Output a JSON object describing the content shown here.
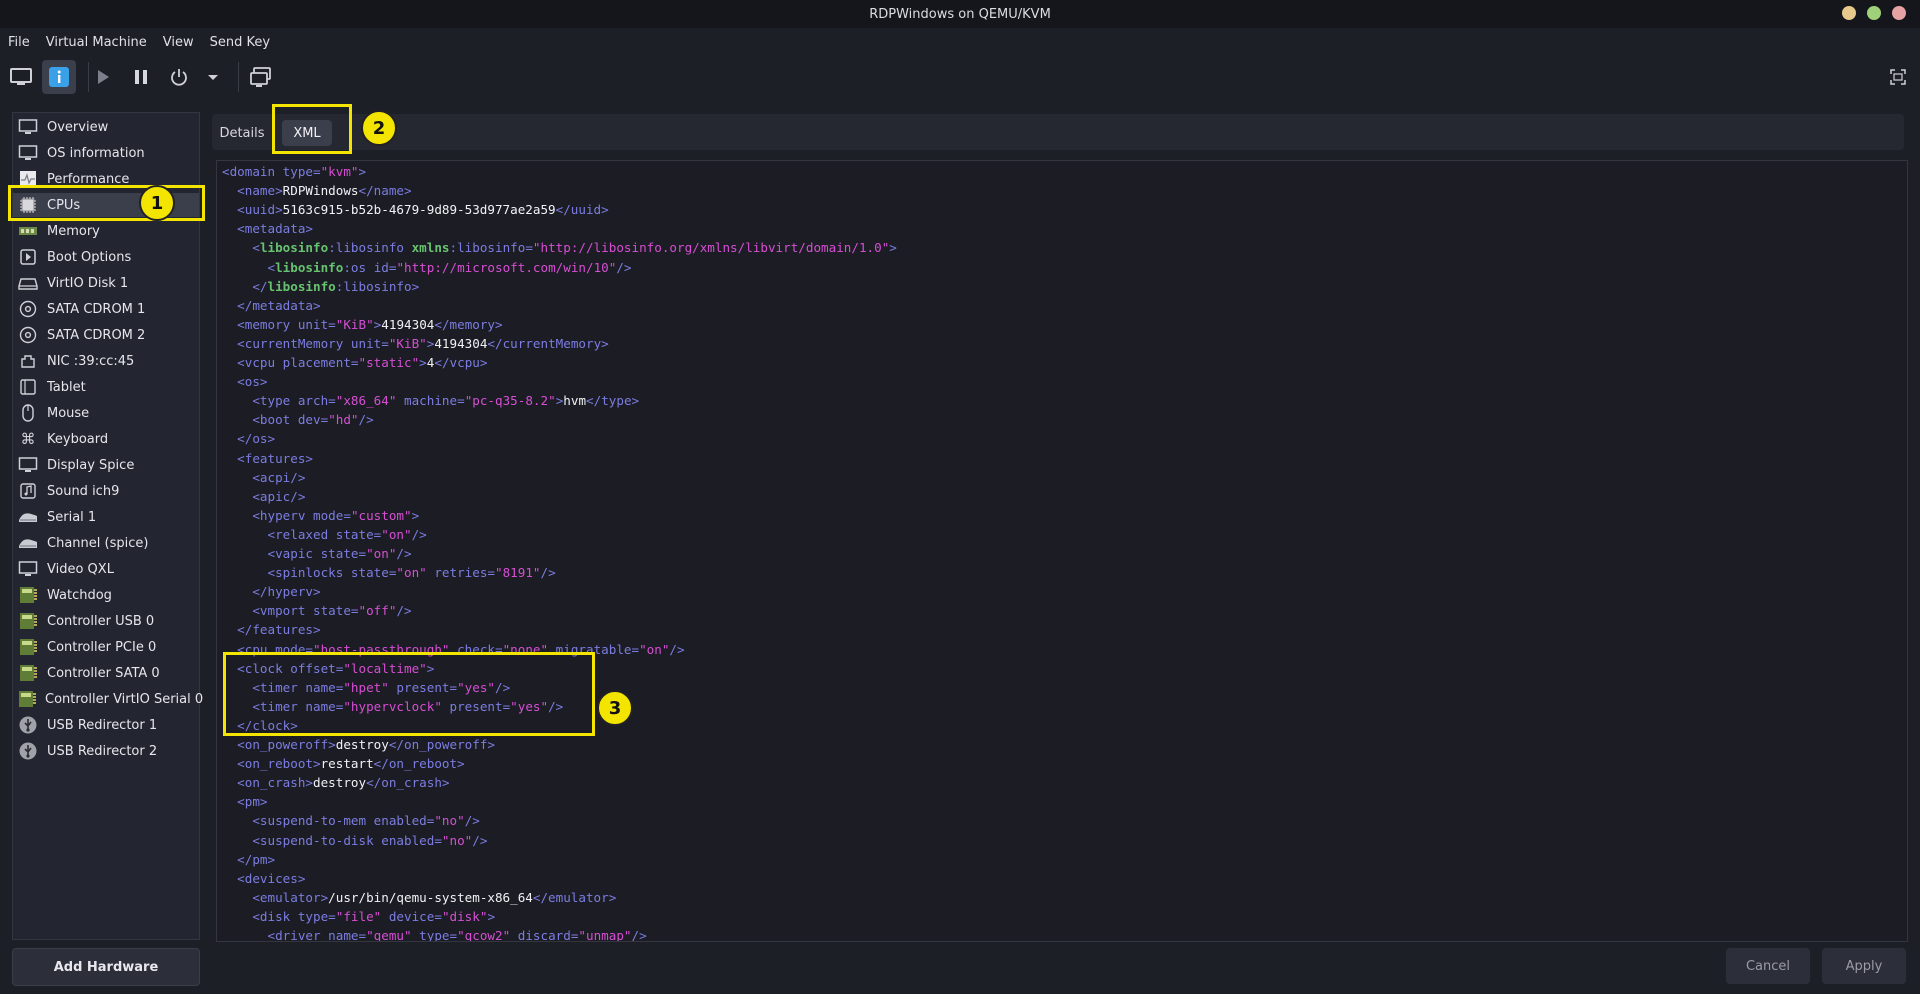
{
  "window": {
    "title": "RDPWindows on QEMU/KVM",
    "buttons": [
      "#e6c98b",
      "#9fd17a",
      "#e7a3a3"
    ]
  },
  "menu": [
    "File",
    "Virtual Machine",
    "View",
    "Send Key"
  ],
  "toolbar": {
    "icons": [
      "monitor-icon",
      "info-icon",
      "play-icon",
      "pause-icon",
      "power-icon",
      "dropdown-arrow-icon",
      "screenshot-icon",
      "fullscreen-icon"
    ]
  },
  "sidebar": {
    "items": [
      {
        "label": "Overview",
        "icon": "monitor-icon"
      },
      {
        "label": "OS information",
        "icon": "monitor-icon"
      },
      {
        "label": "Performance",
        "icon": "chart-icon"
      },
      {
        "label": "CPUs",
        "icon": "cpu-icon"
      },
      {
        "label": "Memory",
        "icon": "memory-icon"
      },
      {
        "label": "Boot Options",
        "icon": "boot-icon"
      },
      {
        "label": "VirtIO Disk 1",
        "icon": "disk-icon"
      },
      {
        "label": "SATA CDROM 1",
        "icon": "cdrom-icon"
      },
      {
        "label": "SATA CDROM 2",
        "icon": "cdrom-icon"
      },
      {
        "label": "NIC :39:cc:45",
        "icon": "network-icon"
      },
      {
        "label": "Tablet",
        "icon": "tablet-icon"
      },
      {
        "label": "Mouse",
        "icon": "mouse-icon"
      },
      {
        "label": "Keyboard",
        "icon": "keyboard-icon"
      },
      {
        "label": "Display Spice",
        "icon": "monitor-icon"
      },
      {
        "label": "Sound ich9",
        "icon": "sound-icon"
      },
      {
        "label": "Serial 1",
        "icon": "serial-icon"
      },
      {
        "label": "Channel (spice)",
        "icon": "serial-icon"
      },
      {
        "label": "Video QXL",
        "icon": "monitor-icon"
      },
      {
        "label": "Watchdog",
        "icon": "card-icon"
      },
      {
        "label": "Controller USB 0",
        "icon": "card-icon"
      },
      {
        "label": "Controller PCIe 0",
        "icon": "card-icon"
      },
      {
        "label": "Controller SATA 0",
        "icon": "card-icon"
      },
      {
        "label": "Controller VirtIO Serial 0",
        "icon": "card-icon"
      },
      {
        "label": "USB Redirector 1",
        "icon": "usb-icon"
      },
      {
        "label": "USB Redirector 2",
        "icon": "usb-icon"
      }
    ],
    "selected": "CPUs",
    "add_hardware": "Add Hardware"
  },
  "tabs": {
    "details": "Details",
    "xml": "XML",
    "active": "XML"
  },
  "xml_lines": [
    "0|<t><domain </t><a>type=</a><v>\"kvm\"</v><t>></t>",
    "1|<t><name></t><x>RDPWindows</x><t></name></t>",
    "1|<t><uuid></t><x>5163c915-b52b-4679-9d89-53d977ae2a59</x><t></uuid></t>",
    "1|<t><metadata></t>",
    "2|<t><</t><b>libosinfo</b><t>:libosinfo </t><b>xmlns</b><a>:libosinfo=</a><v>\"http://libosinfo.org/xmlns/libvirt/domain/1.0\"</v><t>></t>",
    "3|<t><</t><b>libosinfo</b><t>:os </t><a>id=</a><v>\"http://microsoft.com/win/10\"</v><t>/></t>",
    "2|<t></</t><b>libosinfo</b><t>:libosinfo></t>",
    "1|<t></metadata></t>",
    "1|<t><memory </t><a>unit=</a><v>\"KiB\"</v><t>></t><x>4194304</x><t></memory></t>",
    "1|<t><currentMemory </t><a>unit=</a><v>\"KiB\"</v><t>></t><x>4194304</x><t></currentMemory></t>",
    "1|<t><vcpu </t><a>placement=</a><v>\"static\"</v><t>></t><x>4</x><t></vcpu></t>",
    "1|<t><os></t>",
    "2|<t><type </t><a>arch=</a><v>\"x86_64\"</v><a> machine=</a><v>\"pc-q35-8.2\"</v><t>></t><x>hvm</x><t></type></t>",
    "2|<t><boot </t><a>dev=</a><v>\"hd\"</v><t>/></t>",
    "1|<t></os></t>",
    "1|<t><features></t>",
    "2|<t><acpi/></t>",
    "2|<t><apic/></t>",
    "2|<t><hyperv </t><a>mode=</a><v>\"custom\"</v><t>></t>",
    "3|<t><relaxed </t><a>state=</a><v>\"on\"</v><t>/></t>",
    "3|<t><vapic </t><a>state=</a><v>\"on\"</v><t>/></t>",
    "3|<t><spinlocks </t><a>state=</a><v>\"on\"</v><a> retries=</a><v>\"8191\"</v><t>/></t>",
    "2|<t></hyperv></t>",
    "2|<t><vmport </t><a>state=</a><v>\"off\"</v><t>/></t>",
    "1|<t></features></t>",
    "1|<t><cpu </t><a>mode=</a><v>\"host-passthrough\"</v><a> check=</a><v>\"none\"</v><a> migratable=</a><v>\"on\"</v><t>/></t>",
    "1|<t><clock </t><a>offset=</a><v>\"localtime\"</v><t>></t>",
    "2|<t><timer </t><a>name=</a><v>\"hpet\"</v><a> present=</a><v>\"yes\"</v><t>/></t>",
    "2|<t><timer </t><a>name=</a><v>\"hypervclock\"</v><a> present=</a><v>\"yes\"</v><t>/></t>",
    "1|<t></clock></t>",
    "1|<t><on_poweroff></t><x>destroy</x><t></on_poweroff></t>",
    "1|<t><on_reboot></t><x>restart</x><t></on_reboot></t>",
    "1|<t><on_crash></t><x>destroy</x><t></on_crash></t>",
    "1|<t><pm></t>",
    "2|<t><suspend-to-mem </t><a>enabled=</a><v>\"no\"</v><t>/></t>",
    "2|<t><suspend-to-disk </t><a>enabled=</a><v>\"no\"</v><t>/></t>",
    "1|<t></pm></t>",
    "1|<t><devices></t>",
    "2|<t><emulator></t><x>/usr/bin/qemu-system-x86_64</x><t></emulator></t>",
    "2|<t><disk </t><a>type=</a><v>\"file\"</v><a> device=</a><v>\"disk\"</v><t>></t>",
    "3|<t><driver </t><a>name=</a><v>\"qemu\"</v><a> type=</a><v>\"qcow2\"</v><a> discard=</a><v>\"unmap\"</v><t>/></t>"
  ],
  "buttons": {
    "cancel": "Cancel",
    "apply": "Apply"
  },
  "annotations": {
    "one": "1",
    "two": "2",
    "three": "3"
  },
  "colors": {
    "highlight": "#f4e500",
    "xml_tag": "#7c7de0",
    "xml_value": "#d64fd3",
    "xml_ns": "#67c36f"
  }
}
